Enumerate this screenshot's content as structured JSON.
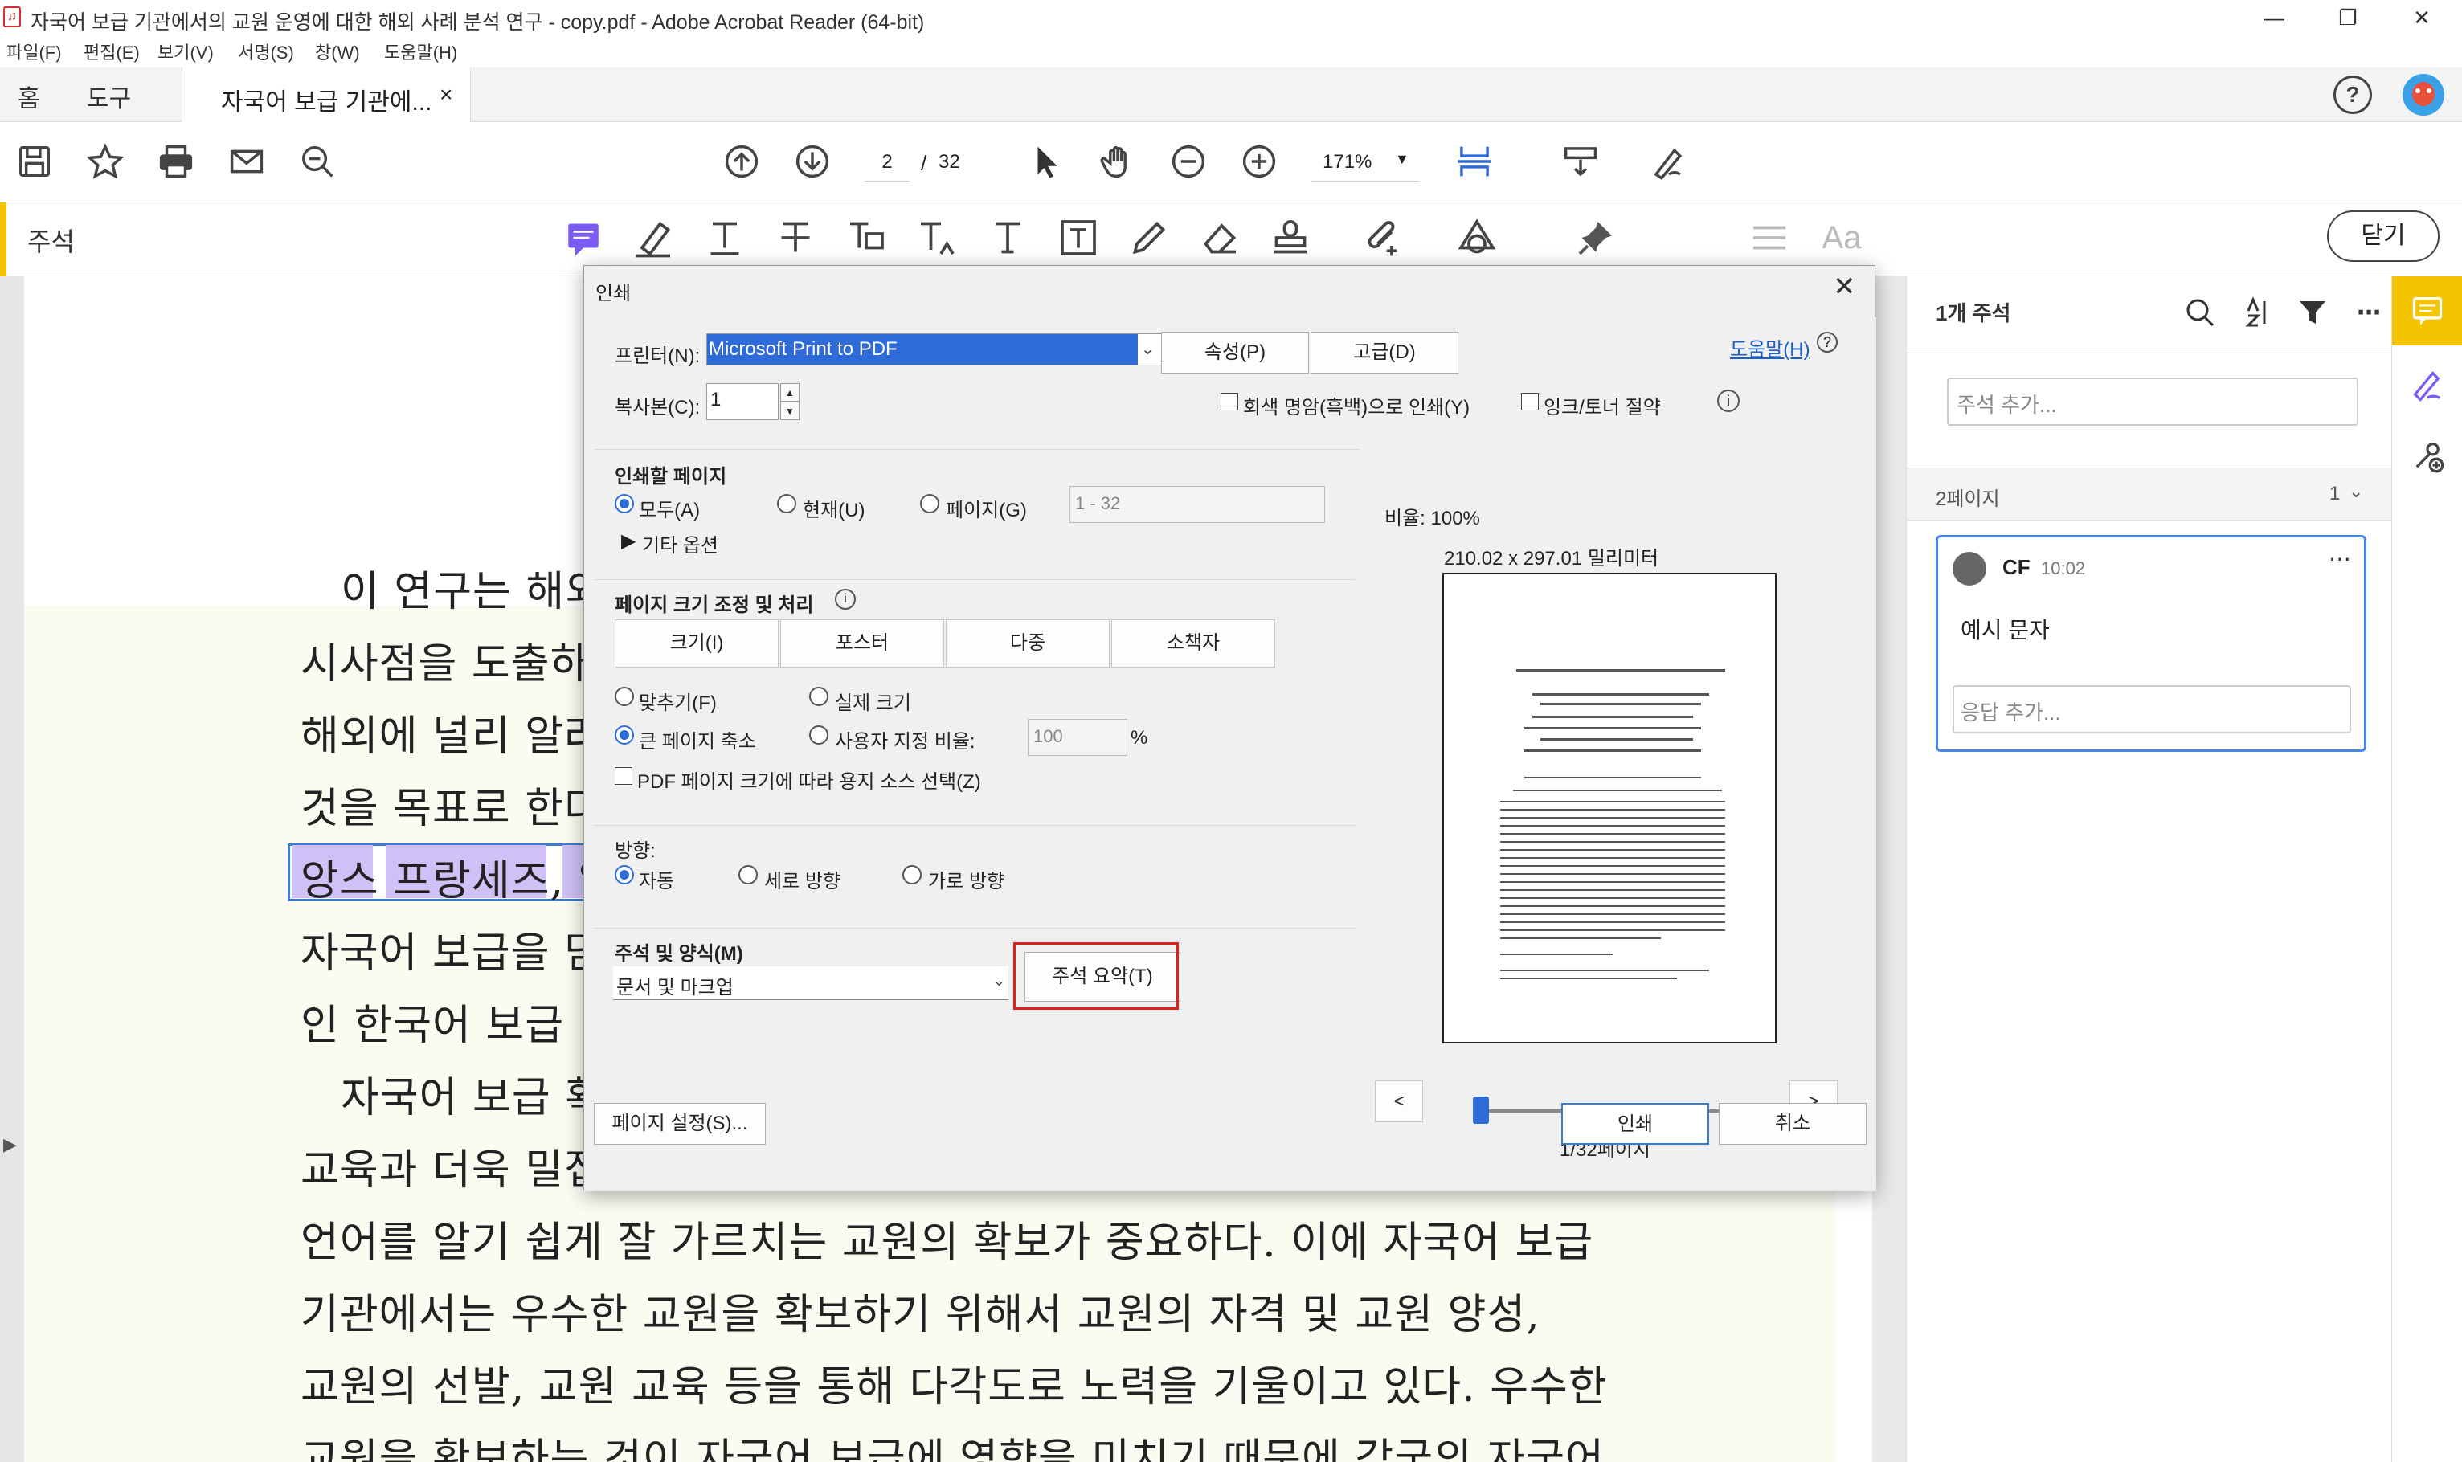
{
  "window": {
    "title": "자국어 보급 기관에서의 교원 운영에 대한 해외 사례 분석 연구 - copy.pdf - Adobe Acrobat Reader (64-bit)",
    "minimize": "—",
    "restore": "❐",
    "close": "✕"
  },
  "menu": [
    "파일(F)",
    "편집(E)",
    "보기(V)",
    "서명(S)",
    "창(W)",
    "도움말(H)"
  ],
  "tabs": {
    "home": "홈",
    "tools": "도구",
    "doc": "자국어 보급 기관에...",
    "doc_close": "×"
  },
  "toolbar": {
    "page_current": "2",
    "page_sep": "/",
    "page_total": "32",
    "zoom": "171%"
  },
  "annotation_bar": {
    "label": "주석",
    "close_label": "닫기",
    "font_label": "Aa"
  },
  "document": {
    "lines": [
      "이 연구는 해외",
      "시사점을 도출하",
      "해외에 널리 알려",
      "것을 목표로 한다",
      "앙스 프랑세즈, 알",
      "자국어 보급을 담",
      "인 한국어 보급",
      "자국어 보급 확",
      "교육과 더욱 밀접",
      "언어를 알기 쉽게 잘 가르치는 교원의 확보가 중요하다. 이에 자국어 보급",
      "기관에서는 우수한 교원을 확보하기 위해서 교원의 자격 및 교원 양성,",
      "교원의 선발, 교원 교육 등을 통해 다각도로 노력을 기울이고 있다. 우수한",
      "교원을 확보하는 것이 자국어 보급에 영향을 미치기 때문에 각국의 자국어"
    ]
  },
  "comments_panel": {
    "count_label": "1개 주석",
    "add_placeholder": "주석 추가...",
    "page_label": "2페이지",
    "page_count": "1",
    "comment": {
      "author": "CF",
      "time": "10:02",
      "text": "예시 문자",
      "reply_placeholder": "응답 추가..."
    }
  },
  "print_dialog": {
    "title": "인쇄",
    "printer_label": "프린터(N):",
    "printer_value": "Microsoft Print to PDF",
    "properties": "속성(P)",
    "advanced": "고급(D)",
    "help": "도움말(H)",
    "copies_label": "복사본(C):",
    "copies_value": "1",
    "grayscale": "회색 명암(흑백)으로 인쇄(Y)",
    "save_ink": "잉크/토너 절약",
    "pages_title": "인쇄할 페이지",
    "all": "모두(A)",
    "current": "현재(U)",
    "pages": "페이지(G)",
    "pages_value": "1 - 32",
    "more_options": "기타 옵션",
    "sizing_title": "페이지 크기 조정 및 처리",
    "size_tab": "크기(I)",
    "poster_tab": "포스터",
    "multiple_tab": "다중",
    "booklet_tab": "소책자",
    "fit": "맞추기(F)",
    "actual_size": "실제 크기",
    "shrink": "큰 페이지 축소",
    "custom_scale": "사용자 지정 비율:",
    "custom_scale_value": "100",
    "percent": "%",
    "choose_source": "PDF 페이지 크기에 따라 용지 소스 선택(Z)",
    "orientation_title": "방향:",
    "auto": "자동",
    "portrait": "세로 방향",
    "landscape": "가로 방향",
    "comments_title": "주석 및 양식(M)",
    "comments_value": "문서 및 마크업",
    "summarize": "주석 요약(T)",
    "page_setup": "페이지 설정(S)...",
    "print": "인쇄",
    "cancel": "취소",
    "scale_label": "비율: 100%",
    "dimensions": "210.02 x 297.01 밀리미터",
    "prev": "<",
    "next": ">",
    "page_indicator": "1/32페이지"
  },
  "colors": {
    "accent_yellow": "#f5c400",
    "highlight_purple": "#cfc0f5",
    "selection_blue": "#2e6bd6",
    "red_outline": "#e0201c"
  }
}
